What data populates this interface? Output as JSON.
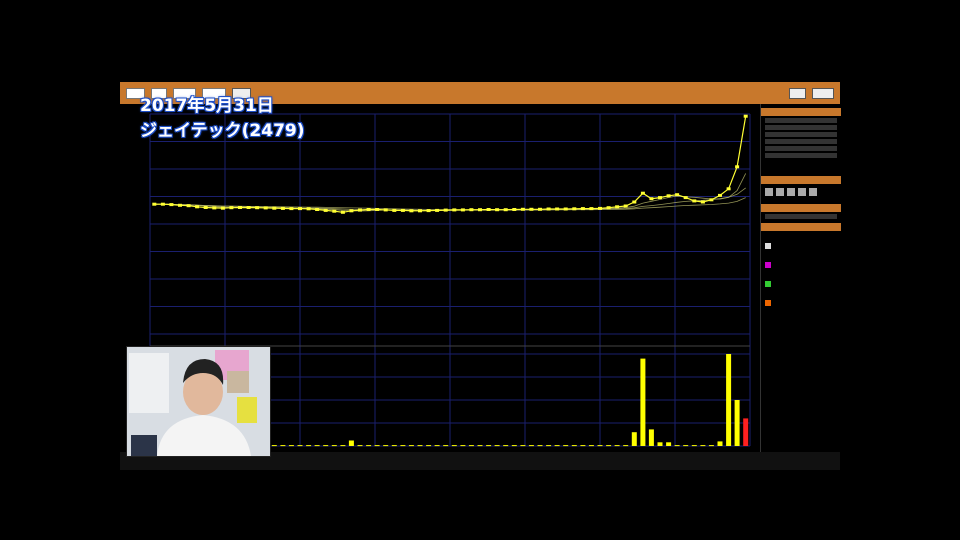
{
  "overlay": {
    "date_text": "2017年5月31日",
    "stock_name": "ジェイテック(2479)"
  },
  "colors": {
    "toolbar": "#c8782c",
    "price": "#ffff33",
    "volume": "#ffff00",
    "volume_last": "#ff2020",
    "grid": "#1a1f6e",
    "ma_lines": "#b8b86a"
  },
  "chart_data": {
    "type": "line",
    "price_series": [
      0.59,
      0.59,
      0.588,
      0.585,
      0.583,
      0.578,
      0.575,
      0.573,
      0.572,
      0.574,
      0.575,
      0.575,
      0.574,
      0.573,
      0.572,
      0.571,
      0.57,
      0.57,
      0.569,
      0.566,
      0.562,
      0.558,
      0.553,
      0.56,
      0.563,
      0.566,
      0.566,
      0.564,
      0.562,
      0.562,
      0.56,
      0.56,
      0.561,
      0.562,
      0.563,
      0.564,
      0.564,
      0.565,
      0.565,
      0.566,
      0.565,
      0.565,
      0.566,
      0.567,
      0.567,
      0.567,
      0.568,
      0.568,
      0.568,
      0.569,
      0.57,
      0.57,
      0.571,
      0.574,
      0.578,
      0.582,
      0.6,
      0.64,
      0.615,
      0.62,
      0.628,
      0.633,
      0.62,
      0.605,
      0.6,
      0.61,
      0.63,
      0.66,
      0.76,
      0.99
    ],
    "volume_series": [
      0.01,
      0.01,
      0.01,
      0.01,
      0.01,
      0.01,
      0.01,
      0.01,
      0.01,
      0.01,
      0.01,
      0.01,
      0.01,
      0.01,
      0.01,
      0.01,
      0.01,
      0.01,
      0.01,
      0.01,
      0.01,
      0.01,
      0.01,
      0.06,
      0.01,
      0.01,
      0.01,
      0.01,
      0.01,
      0.01,
      0.01,
      0.01,
      0.01,
      0.01,
      0.01,
      0.01,
      0.01,
      0.01,
      0.01,
      0.01,
      0.01,
      0.01,
      0.01,
      0.01,
      0.01,
      0.01,
      0.01,
      0.01,
      0.01,
      0.01,
      0.01,
      0.01,
      0.01,
      0.01,
      0.01,
      0.01,
      0.15,
      0.95,
      0.18,
      0.04,
      0.04,
      0.01,
      0.01,
      0.01,
      0.01,
      0.01,
      0.05,
      1.0,
      0.5,
      0.3
    ],
    "grid": true
  }
}
